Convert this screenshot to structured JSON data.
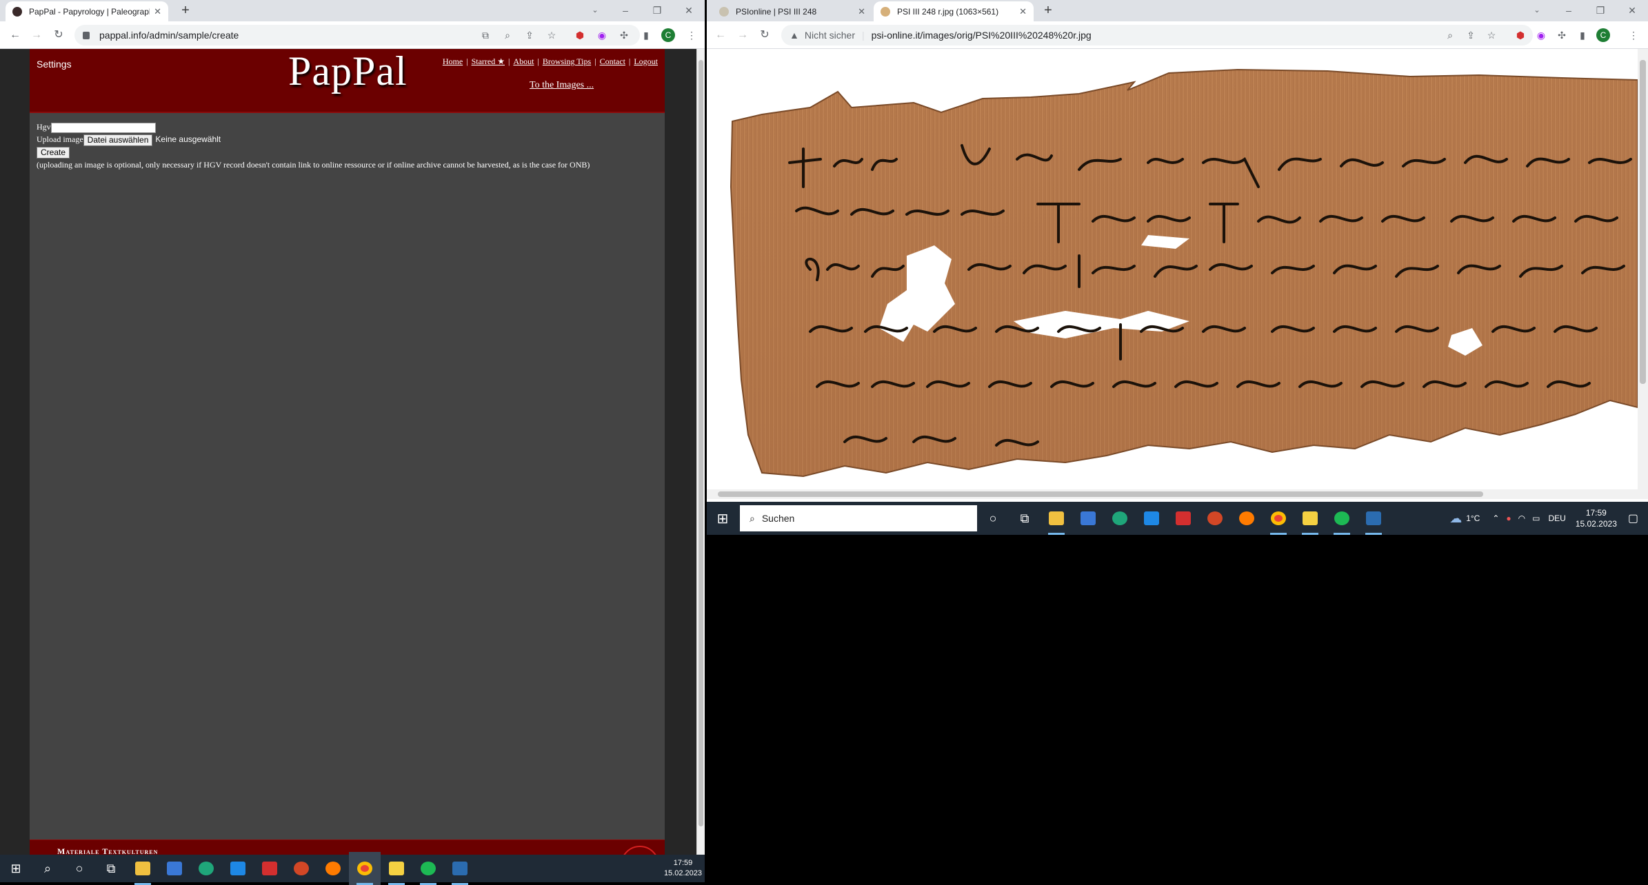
{
  "left_window": {
    "tab": {
      "title": "PapPal - Papyrology | Paleograph",
      "favicon": "pappal-favicon-icon"
    },
    "url": "pappal.info/admin/sample/create",
    "profile_initial": "C",
    "page": {
      "settings_label": "Settings",
      "logo": "PapPal",
      "nav": [
        {
          "label": "Home"
        },
        {
          "label": "Starred ★"
        },
        {
          "label": "About"
        },
        {
          "label": "Browsing Tips"
        },
        {
          "label": "Contact"
        },
        {
          "label": "Logout"
        }
      ],
      "to_images": "To the Images ...",
      "form": {
        "hgv_label": "Hgv",
        "hgv_value": "",
        "upload_label": "Upload image",
        "file_button": "Datei auswählen",
        "file_status": "Keine ausgewählt",
        "create_button": "Create",
        "note": "(uploading an image is optional, only necessary if HGV record doesn't contain link to online ressource or if online archive cannot be harvested, as is the case for ONB)"
      },
      "footer_text": "Materiale Textkulturen"
    }
  },
  "right_window": {
    "tabs": [
      {
        "title": "PSIonline | PSI III 248",
        "active": false
      },
      {
        "title": "PSI III 248 r.jpg (1063×561)",
        "active": true
      }
    ],
    "security": "Nicht sicher",
    "url": "psi-online.it/images/orig/PSI%20III%20248%20r.jpg",
    "profile_initial": "C",
    "image_alt": "papyrus-fragment"
  },
  "taskbar_right": {
    "search_placeholder": "Suchen",
    "weather": "1°C",
    "language": "DEU",
    "time": "17:59",
    "date": "15.02.2023"
  },
  "taskbar_left": {
    "time": "17:59",
    "date": "15.02.2023"
  },
  "colors": {
    "pappal_header": "#6b0000",
    "pappal_body": "#444444",
    "taskbar": "#1f2a36",
    "papyrus": "#b57a4c"
  }
}
